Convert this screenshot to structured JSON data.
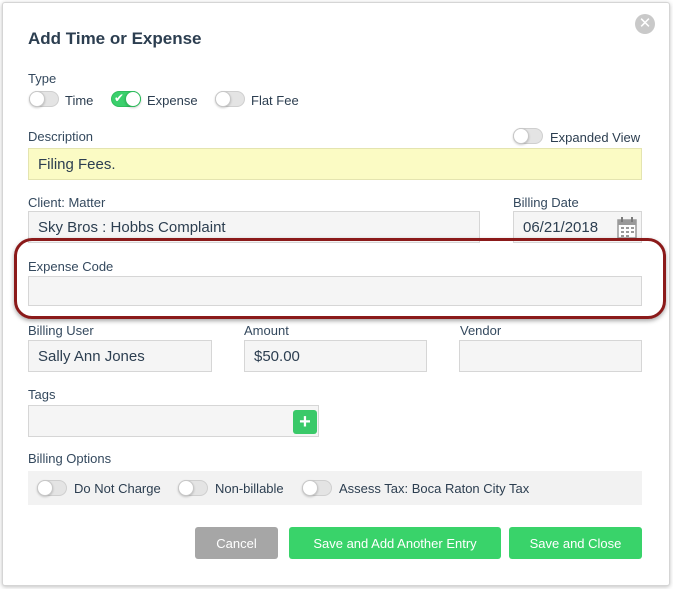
{
  "dialog": {
    "title": "Add Time or Expense",
    "close_icon": "close-icon"
  },
  "type": {
    "label": "Type",
    "options": [
      {
        "label": "Time",
        "on": false
      },
      {
        "label": "Expense",
        "on": true
      },
      {
        "label": "Flat Fee",
        "on": false
      }
    ]
  },
  "description": {
    "label": "Description",
    "value": "Filing Fees.",
    "expanded_view_label": "Expanded View",
    "expanded_view_on": false
  },
  "client_matter": {
    "label": "Client: Matter",
    "value": "Sky Bros : Hobbs Complaint"
  },
  "billing_date": {
    "label": "Billing Date",
    "value": "06/21/2018",
    "icon": "calendar-icon"
  },
  "expense_code": {
    "label": "Expense Code",
    "value": ""
  },
  "billing_user": {
    "label": "Billing User",
    "value": "Sally Ann Jones"
  },
  "amount": {
    "label": "Amount",
    "value": "$50.00"
  },
  "vendor": {
    "label": "Vendor",
    "value": ""
  },
  "tags": {
    "label": "Tags",
    "value": "",
    "add_icon": "plus-icon"
  },
  "billing_options": {
    "label": "Billing Options",
    "options": [
      {
        "label": "Do Not Charge",
        "on": false
      },
      {
        "label": "Non-billable",
        "on": false
      },
      {
        "label": "Assess Tax: Boca Raton City Tax",
        "on": false
      }
    ]
  },
  "buttons": {
    "cancel": "Cancel",
    "save_add_another": "Save and Add Another Entry",
    "save_close": "Save and Close"
  },
  "colors": {
    "accent_green": "#39d36a",
    "highlight_red": "#8b1a1a",
    "description_bg": "#fbfbc4"
  }
}
